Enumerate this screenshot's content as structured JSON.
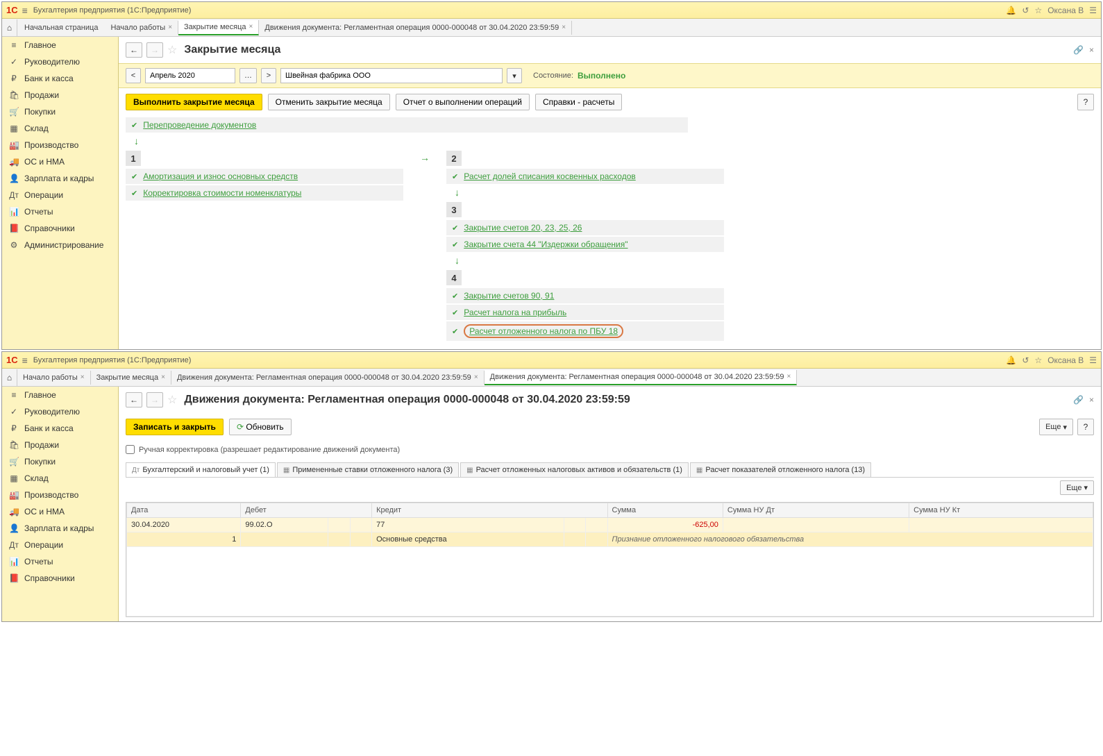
{
  "app": {
    "title": "Бухгалтерия предприятия  (1С:Предприятие)",
    "user": "Оксана В"
  },
  "sidebar": {
    "items": [
      {
        "icon": "≡",
        "label": "Главное"
      },
      {
        "icon": "✓",
        "label": "Руководителю"
      },
      {
        "icon": "₽",
        "label": "Банк и касса"
      },
      {
        "icon": "🛍",
        "label": "Продажи"
      },
      {
        "icon": "🛒",
        "label": "Покупки"
      },
      {
        "icon": "▦",
        "label": "Склад"
      },
      {
        "icon": "🏭",
        "label": "Производство"
      },
      {
        "icon": "🚚",
        "label": "ОС и НМА"
      },
      {
        "icon": "👤",
        "label": "Зарплата и кадры"
      },
      {
        "icon": "Дт",
        "label": "Операции"
      },
      {
        "icon": "📊",
        "label": "Отчеты"
      },
      {
        "icon": "📕",
        "label": "Справочники"
      },
      {
        "icon": "⚙",
        "label": "Администрирование"
      }
    ]
  },
  "win1": {
    "start_tab": "Начальная страница",
    "tabs": [
      {
        "label": "Начало работы"
      },
      {
        "label": "Закрытие месяца",
        "active": true
      },
      {
        "label": "Движения документа: Регламентная операция 0000-000048 от 30.04.2020 23:59:59"
      }
    ],
    "page_title": "Закрытие месяца",
    "period": "Апрель 2020",
    "org": "Швейная фабрика ООО",
    "status_label": "Состояние:",
    "status_value": "Выполнено",
    "btn_execute": "Выполнить закрытие месяца",
    "btn_cancel": "Отменить закрытие месяца",
    "btn_report": "Отчет о выполнении операций",
    "btn_ref": "Справки - расчеты",
    "repost": "Перепроведение документов",
    "stage1": {
      "ops": [
        "Амортизация и износ основных средств",
        "Корректировка стоимости номенклатуры"
      ]
    },
    "stage2": {
      "ops": [
        "Расчет долей списания косвенных расходов"
      ]
    },
    "stage3": {
      "ops": [
        "Закрытие счетов 20, 23, 25, 26",
        "Закрытие счета 44 \"Издержки обращения\""
      ]
    },
    "stage4": {
      "ops": [
        "Закрытие счетов 90, 91",
        "Расчет налога на прибыль",
        "Расчет отложенного налога по ПБУ 18"
      ]
    }
  },
  "win2": {
    "tabs": [
      {
        "label": "Начало работы"
      },
      {
        "label": "Закрытие месяца"
      },
      {
        "label": "Движения документа: Регламентная операция 0000-000048 от 30.04.2020 23:59:59"
      },
      {
        "label": "Движения документа: Регламентная операция 0000-000048 от 30.04.2020 23:59:59",
        "active": true
      }
    ],
    "page_title": "Движения документа: Регламентная операция 0000-000048 от 30.04.2020 23:59:59",
    "btn_save": "Записать и закрыть",
    "btn_refresh": "Обновить",
    "btn_more": "Еще",
    "checkbox_label": "Ручная корректировка (разрешает редактирование движений документа)",
    "subtabs": [
      "Бухгалтерский и налоговый учет (1)",
      "Примененные ставки отложенного налога (3)",
      "Расчет отложенных налоговых активов и обязательств (1)",
      "Расчет показателей отложенного налога (13)"
    ],
    "table": {
      "headers": [
        "Дата",
        "Дебет",
        "",
        "",
        "Кредит",
        "",
        "",
        "Сумма",
        "Сумма НУ Дт",
        "Сумма НУ Кт"
      ],
      "row1": {
        "date": "30.04.2020",
        "debit": "99.02.О",
        "credit": "77",
        "sum": "-625,00"
      },
      "row2": {
        "idx": "1",
        "credit_desc": "Основные средства",
        "desc": "Признание отложенного налогового обязательства"
      }
    }
  }
}
